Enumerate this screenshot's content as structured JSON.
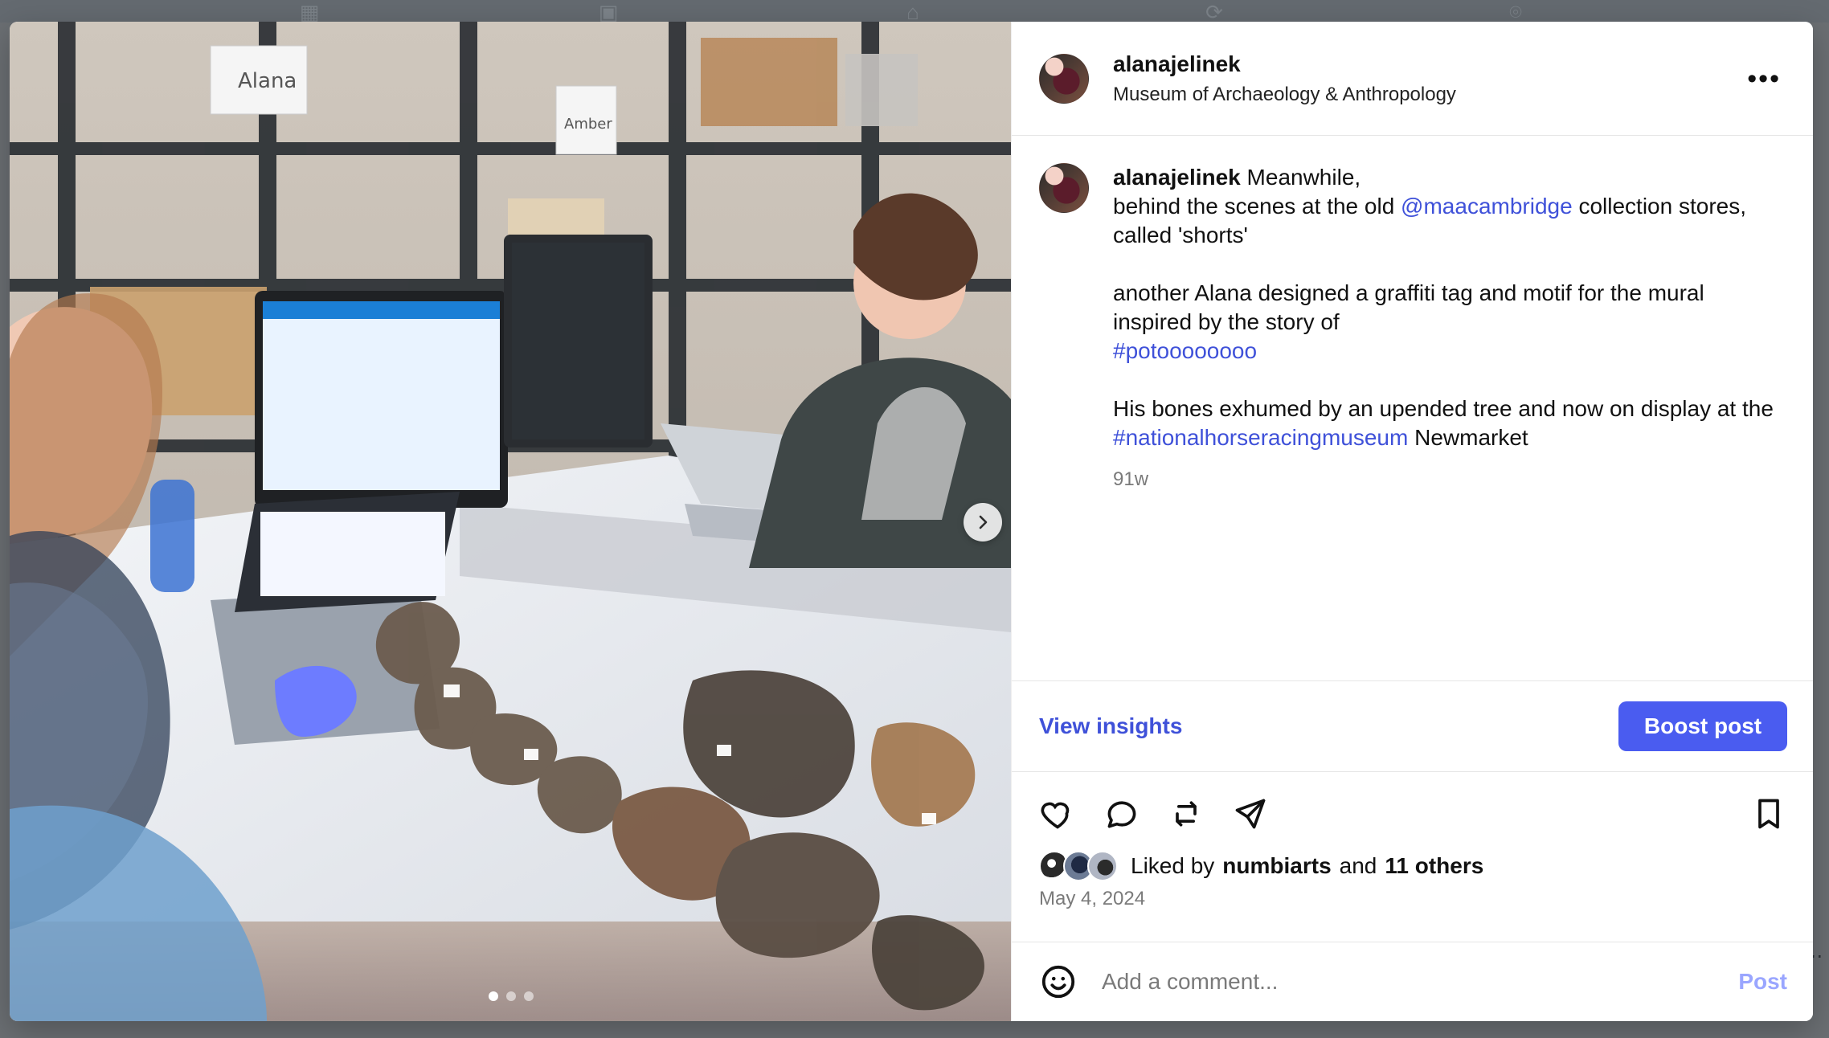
{
  "colors": {
    "link": "#3f51d9",
    "boost_button": "#4a5cf0",
    "post_disabled": "#9aa6ff"
  },
  "post": {
    "author": {
      "username": "alanajelinek",
      "location": "Museum of Archaeology & Anthropology"
    },
    "caption": {
      "username": "alanajelinek",
      "line1_text": "Meanwhile,",
      "line2_prefix": "behind the scenes at the old ",
      "mention": "@maacambridge",
      "line2_suffix": " collection stores,",
      "line3": "called 'shorts'",
      "line4": "another Alana designed a graffiti tag and motif for the mural inspired by the story of",
      "hashtag1": "#potoooooooo",
      "line5_prefix": "His bones exhumed by an upended tree and now on display at the ",
      "hashtag2": "#nationalhorseracingmuseum",
      "line5_suffix": " Newmarket",
      "time_ago": "91w"
    },
    "insights": {
      "view_label": "View insights",
      "boost_label": "Boost post"
    },
    "likes": {
      "prefix": "Liked by",
      "user": "numbiarts",
      "middle": "and",
      "others": "11 others",
      "date": "May 4, 2024"
    },
    "comment": {
      "placeholder": "Add a comment...",
      "post_label": "Post"
    }
  },
  "icons": {
    "more": "more-icon",
    "like": "heart-icon",
    "comment": "comment-icon",
    "repost": "repost-icon",
    "share": "send-icon",
    "save": "bookmark-icon",
    "emoji": "emoji-icon",
    "next": "chevron-right-icon"
  },
  "carousel": {
    "total": 3,
    "active_index": 0
  }
}
